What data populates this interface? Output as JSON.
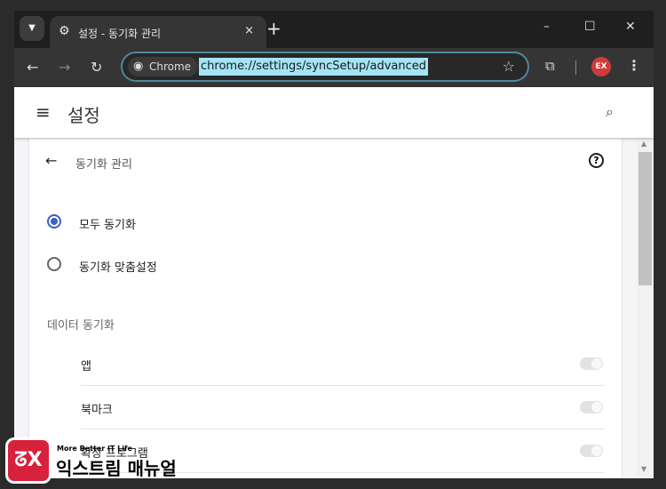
{
  "tab": {
    "title": "설정 - 동기화 관리",
    "close": "×",
    "new": "+"
  },
  "window": {
    "minimize": "–",
    "maximize": "☐",
    "close": "✕"
  },
  "toolbar": {
    "back": "←",
    "forward": "→",
    "reload": "↻",
    "chip": "Chrome",
    "url": "chrome://settings/syncSetup/advanced",
    "star": "☆",
    "extensions": "⧉",
    "profile": "EX",
    "menu": "⋮"
  },
  "header": {
    "title": "설정",
    "menu": "≡",
    "search": "⌕"
  },
  "card": {
    "title": "동기화 관리",
    "back": "←",
    "help": "?",
    "options": [
      {
        "label": "모두 동기화",
        "selected": true
      },
      {
        "label": "동기화 맞춤설정",
        "selected": false
      }
    ],
    "section": "데이터 동기화",
    "items": [
      {
        "label": "앱",
        "on": true,
        "disabled": true
      },
      {
        "label": "북마크",
        "on": true,
        "disabled": true
      },
      {
        "label": "확장 프로그램",
        "on": true,
        "disabled": true
      }
    ]
  },
  "watermark": {
    "tagline": "More Better IT Life",
    "brand": "익스트림 매뉴얼",
    "logo": "EX"
  }
}
